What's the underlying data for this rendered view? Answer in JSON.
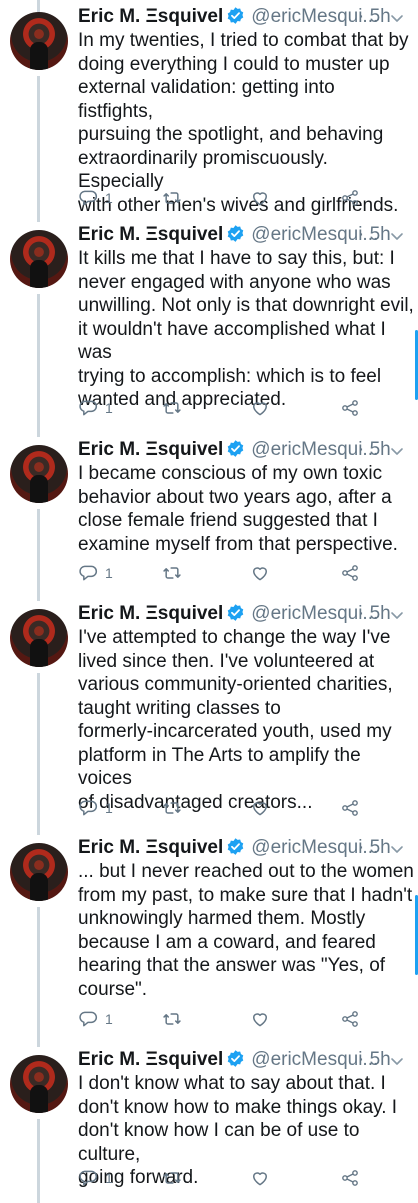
{
  "tweets": [
    {
      "name": "Eric M. Ξsquivel",
      "handle": "@ericMesqui...",
      "time": "· 5h",
      "text": "In my twenties, I tried to combat that by\ndoing everything I could to muster up\nexternal validation: getting into fistfights,\npursuing the spotlight, and behaving\nextraordinarily promiscuously. Especially\nwith other men's wives and girlfriends.",
      "replies": "1"
    },
    {
      "name": "Eric M. Ξsquivel",
      "handle": "@ericMesqui...",
      "time": "· 5h",
      "text": "It kills me that I have to say this, but: I\nnever engaged with anyone who was\nunwilling. Not only is that downright evil,\nit wouldn't have accomplished what I was\ntrying to accomplish: which is to feel\nwanted and appreciated.",
      "replies": "1"
    },
    {
      "name": "Eric M. Ξsquivel",
      "handle": "@ericMesqui...",
      "time": "· 5h",
      "text": "I became conscious of my own toxic\nbehavior about two years ago, after a\nclose female friend suggested that I\nexamine myself from that perspective.",
      "replies": "1"
    },
    {
      "name": "Eric M. Ξsquivel",
      "handle": "@ericMesqui...",
      "time": "· 5h",
      "text": "I've attempted to change the way I've\nlived since then. I've volunteered at\nvarious community-oriented charities,\ntaught writing classes to\nformerly-incarcerated youth, used my\nplatform in The Arts to amplify the voices\nof disadvantaged creators...",
      "replies": "1"
    },
    {
      "name": "Eric M. Ξsquivel",
      "handle": "@ericMesqui...",
      "time": "· 5h",
      "text": "... but I never reached out to the women\nfrom my past, to make sure that I hadn't\nunknowingly harmed them. Mostly\nbecause I am a coward, and feared\nhearing that the answer was \"Yes, of\ncourse\".",
      "replies": "1"
    },
    {
      "name": "Eric M. Ξsquivel",
      "handle": "@ericMesqui...",
      "time": "· 5h",
      "text": "I don't know what to say about that. I\ndon't know how to make things okay. I\ndon't know how I can be of use to culture,\ngoing forward.",
      "replies": "1"
    }
  ],
  "colors": {
    "verified": "#1da1f2",
    "muted": "#657786",
    "thread_line": "#ccd6dd"
  },
  "icons": [
    "reply-icon",
    "retweet-icon",
    "like-icon",
    "share-icon",
    "chevron-down-icon",
    "verified-badge-icon"
  ]
}
